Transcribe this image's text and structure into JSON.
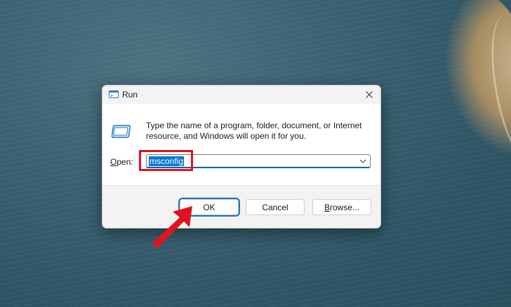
{
  "dialog": {
    "title": "Run",
    "description": "Type the name of a program, folder, document, or Internet resource, and Windows will open it for you.",
    "open_label_prefix": "",
    "open_label_accel": "O",
    "open_label_rest": "pen:",
    "open_value": "msconfig",
    "buttons": {
      "ok": "OK",
      "cancel": "Cancel",
      "browse_accel": "B",
      "browse_rest": "rowse..."
    }
  },
  "icons": {
    "title": "run-icon",
    "body": "run-icon",
    "close": "close-icon",
    "dropdown": "chevron-down-icon",
    "annotation": "arrow-pointer-icon"
  },
  "colors": {
    "accent": "#005fb8",
    "annotation_red": "#e0141e",
    "selection": "#0078d4"
  }
}
